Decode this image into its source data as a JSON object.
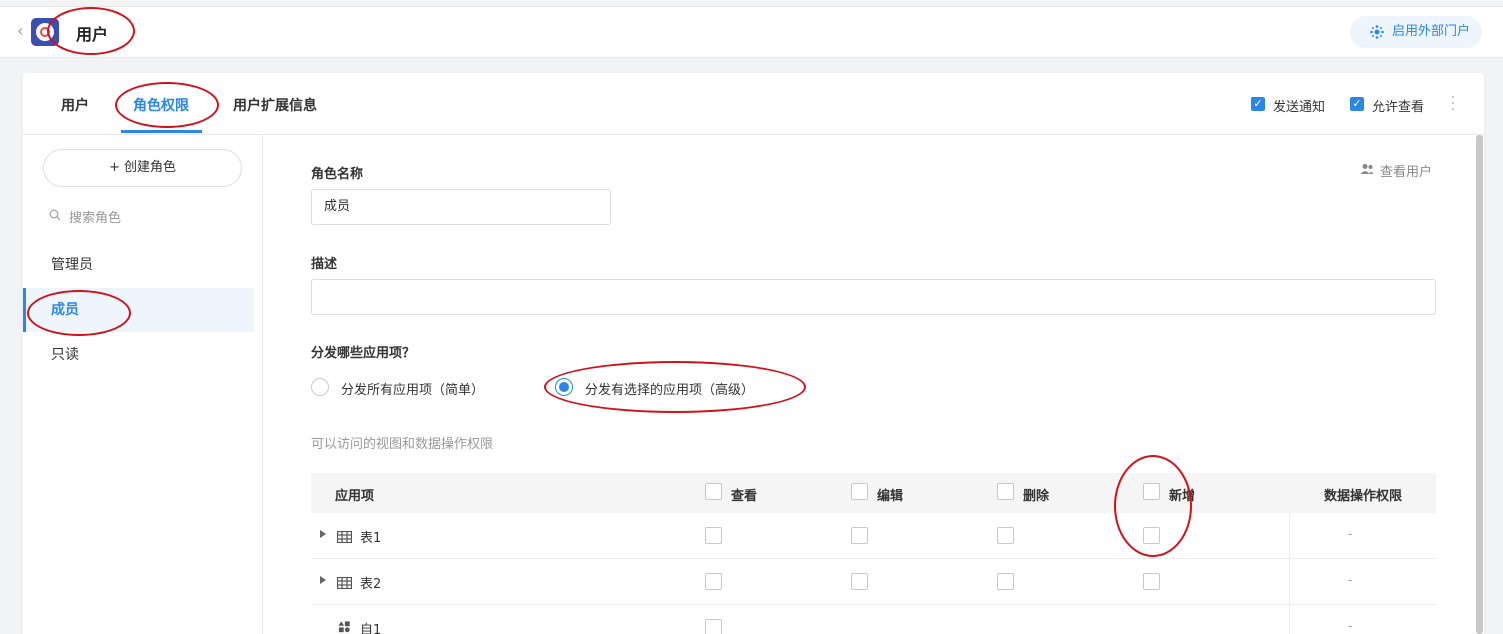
{
  "header": {
    "title": "用户",
    "portal_button": "启用外部门户"
  },
  "tabs": [
    {
      "label": "用户"
    },
    {
      "label": "角色权限"
    },
    {
      "label": "用户扩展信息"
    }
  ],
  "options": {
    "notify_label": "发送通知",
    "allow_view_label": "允许查看"
  },
  "sidebar": {
    "create_label": "+ 创建角色",
    "search_placeholder": "搜索角色",
    "roles": [
      {
        "label": "管理员"
      },
      {
        "label": "成员"
      },
      {
        "label": "只读"
      }
    ]
  },
  "form": {
    "role_name_label": "角色名称",
    "role_name_value": "成员",
    "view_users_label": "查看用户",
    "description_label": "描述",
    "description_value": "",
    "distribute_label": "分发哪些应用项？",
    "radio_all": "分发所有应用项（简单）",
    "radio_selected": "分发有选择的应用项（高级）",
    "permissions_hint": "可以访问的视图和数据操作权限"
  },
  "table": {
    "columns": {
      "app_item": "应用项",
      "view": "查看",
      "edit": "编辑",
      "delete": "删除",
      "add": "新增",
      "data_ops": "数据操作权限"
    },
    "rows": [
      {
        "name": "表1",
        "dash": "-"
      },
      {
        "name": "表2",
        "dash": "-"
      },
      {
        "name": "自1",
        "dash": "-"
      }
    ]
  },
  "colors": {
    "accent": "#2b87e3",
    "annotation": "#d0121b"
  }
}
